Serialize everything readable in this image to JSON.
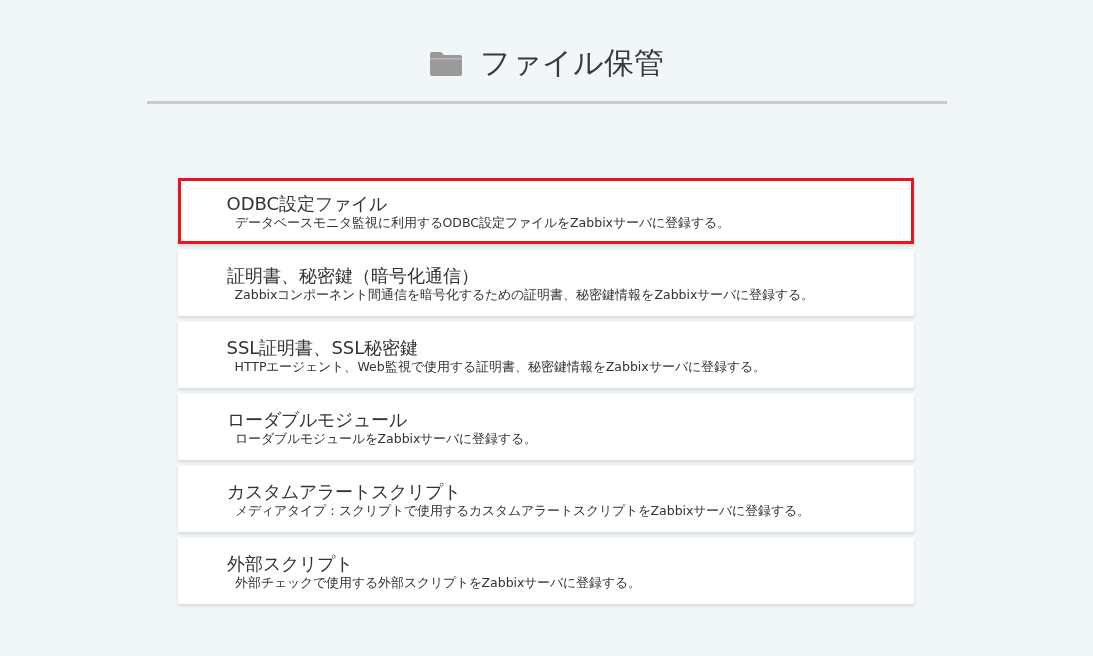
{
  "page": {
    "title": "ファイル保管"
  },
  "items": [
    {
      "title": "ODBC設定ファイル",
      "description": "データベースモニタ監視に利用するODBC設定ファイルをZabbixサーバに登録する。",
      "selected": true
    },
    {
      "title": "証明書、秘密鍵（暗号化通信）",
      "description": "Zabbixコンポーネント間通信を暗号化するための証明書、秘密鍵情報をZabbixサーバに登録する。",
      "selected": false
    },
    {
      "title": "SSL証明書、SSL秘密鍵",
      "description": "HTTPエージェント、Web監視で使用する証明書、秘密鍵情報をZabbixサーバに登録する。",
      "selected": false
    },
    {
      "title": "ローダブルモジュール",
      "description": "ローダブルモジュールをZabbixサーバに登録する。",
      "selected": false
    },
    {
      "title": "カスタムアラートスクリプト",
      "description": "メディアタイプ：スクリプトで使用するカスタムアラートスクリプトをZabbixサーバに登録する。",
      "selected": false
    },
    {
      "title": "外部スクリプト",
      "description": "外部チェックで使用する外部スクリプトをZabbixサーバに登録する。",
      "selected": false
    }
  ]
}
